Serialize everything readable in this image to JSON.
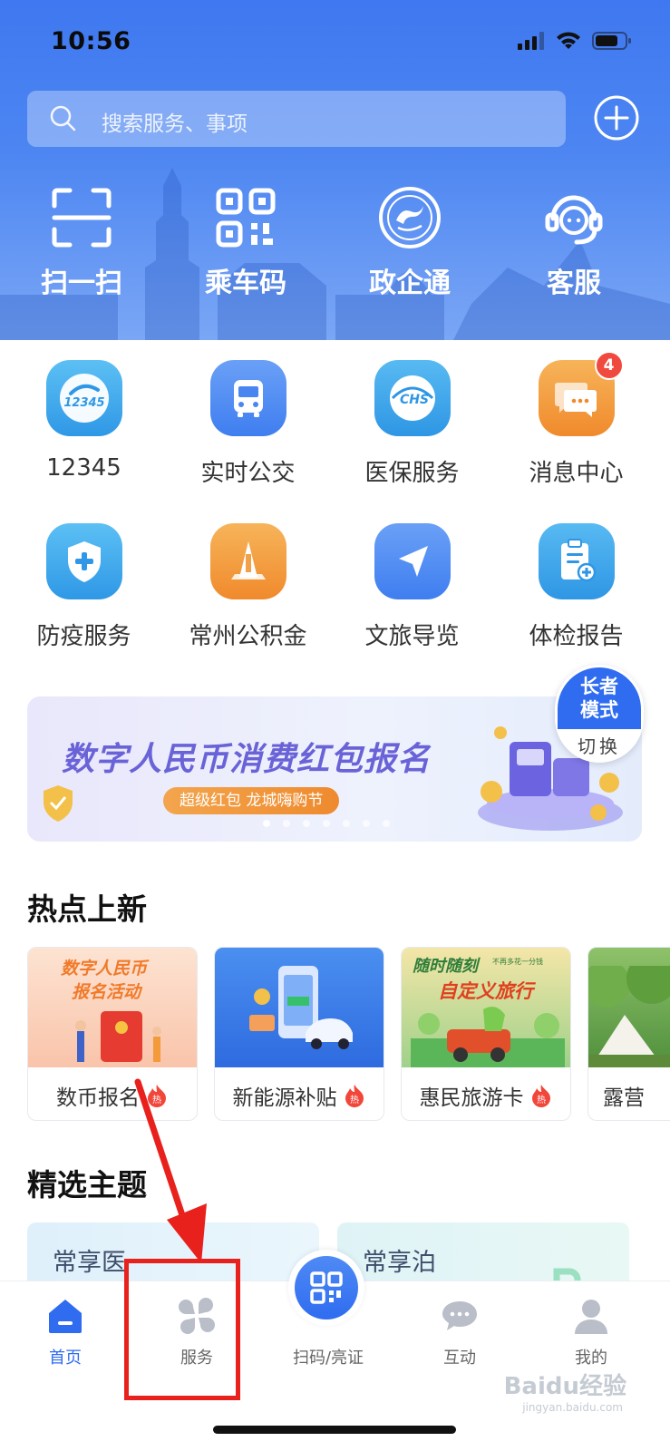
{
  "status": {
    "time": "10:56"
  },
  "search": {
    "placeholder": "搜索服务、事项"
  },
  "top_actions": [
    {
      "label": "扫一扫",
      "icon": "scan-icon"
    },
    {
      "label": "乘车码",
      "icon": "qr-code-icon"
    },
    {
      "label": "政企通",
      "icon": "dragon-emblem-icon"
    },
    {
      "label": "客服",
      "icon": "customer-service-icon"
    }
  ],
  "apps": [
    {
      "label": "12345",
      "icon": "hotline-12345-icon",
      "color": "#3aa8ee"
    },
    {
      "label": "实时公交",
      "icon": "bus-icon",
      "color": "#4a86f2"
    },
    {
      "label": "医保服务",
      "icon": "chs-medical-insurance-icon",
      "color": "#33a8e8"
    },
    {
      "label": "消息中心",
      "icon": "message-icon",
      "color": "#f39a3a",
      "badge": "4"
    },
    {
      "label": "防疫服务",
      "icon": "shield-plus-icon",
      "color": "#3aa8ee"
    },
    {
      "label": "常州公积金",
      "icon": "provident-fund-icon",
      "color": "#f39a3a"
    },
    {
      "label": "文旅导览",
      "icon": "navigation-arrow-icon",
      "color": "#4a86f2"
    },
    {
      "label": "体检报告",
      "icon": "medical-report-icon",
      "color": "#3aa8ee"
    }
  ],
  "banner": {
    "title": "数字人民币消费红包报名",
    "subtitle": "超级红包 龙城嗨购节"
  },
  "elder_mode": {
    "line1": "长者",
    "line2": "模式",
    "switch": "切换"
  },
  "hot_section": {
    "title": "热点上新",
    "cards": [
      {
        "label": "数币报名",
        "thumb_text1": "数字人民币",
        "thumb_text2": "报名活动",
        "hot": true
      },
      {
        "label": "新能源补贴",
        "hot": true
      },
      {
        "label": "惠民旅游卡",
        "thumb_text1": "随时随刻",
        "thumb_text2": "自定义旅行",
        "thumb_text3": "不再多花一分钱",
        "hot": true
      },
      {
        "label": "露营",
        "hot": false
      }
    ],
    "hot_mark": "热"
  },
  "theme_section": {
    "title": "精选主题",
    "cards": [
      {
        "label": "常享医"
      },
      {
        "label": "常享泊"
      }
    ]
  },
  "tabbar": {
    "tabs": [
      {
        "label": "首页",
        "active": true
      },
      {
        "label": "服务"
      },
      {
        "label": "扫码/亮证"
      },
      {
        "label": "互动"
      },
      {
        "label": "我的"
      }
    ]
  },
  "watermark": {
    "text": "Baidu经验",
    "sub": "jingyan.baidu.com"
  },
  "colors": {
    "primary": "#2f6cf0",
    "annotation_red": "#e8211c",
    "badge_red": "#f04a3e"
  }
}
